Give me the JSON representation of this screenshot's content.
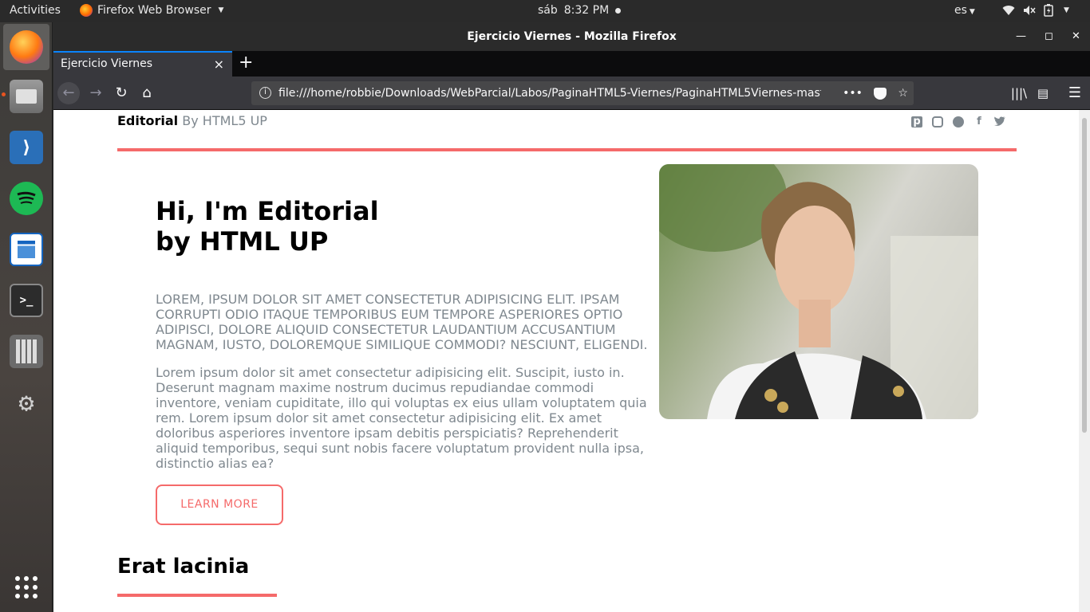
{
  "topbar": {
    "activities": "Activities",
    "app_menu": "Firefox Web Browser",
    "day": "sáb",
    "time": "8:32 PM",
    "language": "es"
  },
  "dock": {
    "items": [
      "firefox-icon",
      "files-icon",
      "vscode-icon",
      "spotify-icon",
      "writer-icon",
      "terminal-icon",
      "calculator-icon",
      "settings-icon",
      "app-grid-icon"
    ]
  },
  "window": {
    "title": "Ejercicio Viernes - Mozilla Firefox"
  },
  "browser": {
    "tab_title": "Ejercicio Viernes",
    "url": "file:///home/robbie/Downloads/WebParcial/Labos/PaginaHTML5-Viernes/PaginaHTML5Viernes-mast"
  },
  "site": {
    "logo_bold": "Editorial",
    "logo_rest": " By HTML5 UP",
    "social_icons": [
      "pinterest-icon",
      "instagram-icon",
      "snapchat-icon",
      "facebook-icon",
      "twitter-icon"
    ]
  },
  "banner": {
    "title_line1": "Hi, I'm Editorial",
    "title_line2": "by HTML UP",
    "lead": "Lorem, ipsum dolor sit amet consectetur adipisicing elit. Ipsam corrupti odio itaque temporibus eum tempore asperiores optio adipisci, dolore aliquid consectetur laudantium accusantium magnam, iusto, doloremque similique commodi? Nesciunt, eligendi.",
    "text": "Lorem ipsum dolor sit amet consectetur adipisicing elit. Suscipit, iusto in. Deserunt magnam maxime nostrum ducimus repudiandae commodi inventore, veniam cupiditate, illo qui voluptas ex eius ullam voluptatem quia rem. Lorem ipsum dolor sit amet consectetur adipisicing elit. Ex amet doloribus asperiores inventore ipsam debitis perspiciatis? Reprehenderit aliquid temporibus, sequi sunt nobis facere voluptatum provident nulla ipsa, distinctio alias ea?",
    "button": "LEARN MORE"
  },
  "section": {
    "title": "Erat lacinia"
  },
  "colors": {
    "accent": "#f56a6a",
    "text": "#7f888f",
    "heading": "#000000",
    "firefox_tab_highlight": "#0a84ff"
  }
}
